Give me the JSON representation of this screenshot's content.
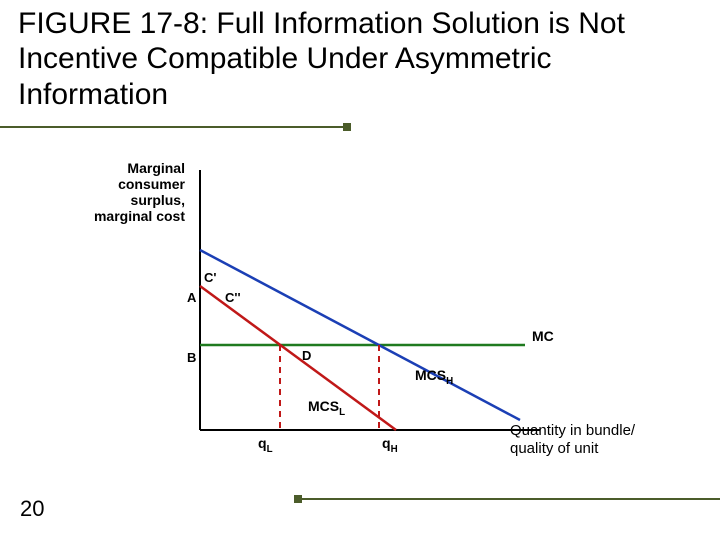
{
  "title": "FIGURE 17-8: Full Information Solution is Not Incentive Compatible Under Asymmetric Information",
  "page_number": "20",
  "y_axis_label": "Marginal consumer surplus, marginal cost",
  "x_axis_label": "Quantity in bundle/ quality of unit",
  "points": {
    "C_prime": "C'",
    "C_dprime": "C''",
    "A": "A",
    "B": "B",
    "D": "D"
  },
  "curves": {
    "MC": "MC",
    "MCS_H": "MCS",
    "MCS_H_sub": "H",
    "MCS_L": "MCS",
    "MCS_L_sub": "L"
  },
  "x_ticks": {
    "qL": "q",
    "qL_sub": "L",
    "qH": "q",
    "qH_sub": "H"
  },
  "chart_data": {
    "type": "line",
    "title": "Full Information Solution is Not Incentive Compatible Under Asymmetric Information",
    "xlabel": "Quantity in bundle / quality of unit",
    "ylabel": "Marginal consumer surplus, marginal cost",
    "xlim": [
      0,
      10
    ],
    "ylim": [
      0,
      10
    ],
    "series": [
      {
        "name": "MC",
        "x": [
          0,
          10
        ],
        "y": [
          3.5,
          3.5
        ]
      },
      {
        "name": "MCS_H",
        "x": [
          0,
          10
        ],
        "y": [
          7.5,
          0.0
        ]
      },
      {
        "name": "MCS_L",
        "x": [
          0,
          6
        ],
        "y": [
          6.0,
          0.0
        ]
      }
    ],
    "verticals": [
      {
        "name": "q_L",
        "x": 2.5
      },
      {
        "name": "q_H",
        "x": 5.3
      }
    ],
    "annotations": [
      {
        "name": "C'",
        "x": 0.0,
        "y": 6.0
      },
      {
        "name": "A",
        "x": 0.0,
        "y": 5.2
      },
      {
        "name": "B",
        "x": 0.0,
        "y": 3.0
      },
      {
        "name": "C''",
        "x": 0.9,
        "y": 5.2
      },
      {
        "name": "D",
        "x": 2.8,
        "y": 3.2
      }
    ]
  }
}
